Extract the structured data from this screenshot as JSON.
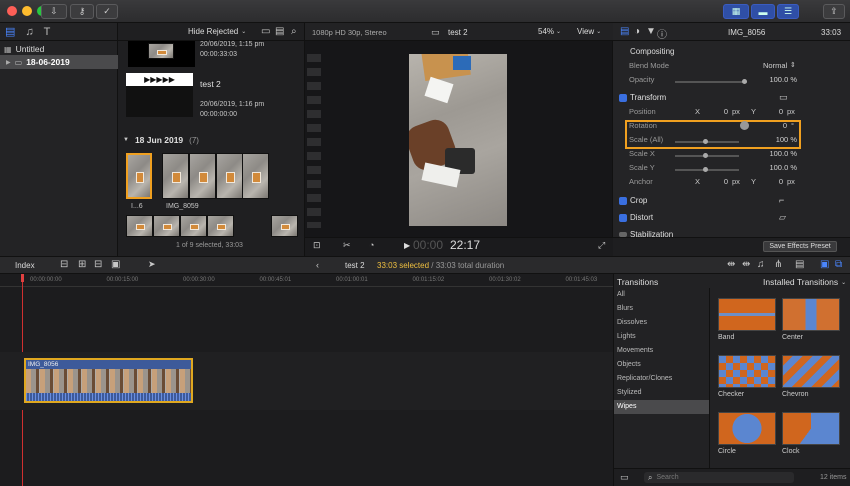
{
  "toolbar": {
    "download_icon": "download-icon",
    "key_icon": "key-icon",
    "check_icon": "checkmark-icon"
  },
  "libraries": {
    "library_name": "Untitled",
    "event_name": "18-06-2019"
  },
  "browser": {
    "filter_label": "Hide Rejected",
    "clip1": {
      "date": "20/06/2019, 1:15 pm",
      "duration": "00:00:33:03"
    },
    "clip2": {
      "name": "test 2",
      "date": "20/06/2019, 1:16 pm",
      "duration": "00:00:00:00"
    },
    "group_label": "18 Jun 2019",
    "group_count": "(7)",
    "clip3_name": "I...6",
    "clip4_name": "IMG_8059",
    "status": "1 of 9 selected, 33:03"
  },
  "viewer": {
    "format": "1080p HD 30p, Stereo",
    "project": "test 2",
    "zoom": "54%",
    "view_label": "View",
    "timecode_dim": "00:00",
    "timecode": "22:17"
  },
  "inspector": {
    "clip_name": "IMG_8056",
    "duration": "33:03",
    "compositing": "Compositing",
    "blend_label": "Blend Mode",
    "blend_value": "Normal",
    "opacity_label": "Opacity",
    "opacity_value": "100.0 %",
    "opacity_fraction": 1.0,
    "transform": "Transform",
    "position_label": "Position",
    "pos_x_label": "X",
    "pos_x": "0",
    "pos_x_unit": "px",
    "pos_y_label": "Y",
    "pos_y": "0",
    "pos_y_unit": "px",
    "rotation_label": "Rotation",
    "rotation_value": "0",
    "rotation_unit": "°",
    "scale_all_label": "Scale (All)",
    "scale_all_value": "100 %",
    "scale_x_label": "Scale X",
    "scale_x_value": "100.0 %",
    "scale_y_label": "Scale Y",
    "scale_y_value": "100.0 %",
    "anchor_label": "Anchor",
    "anchor_x_label": "X",
    "anchor_x": "0",
    "anchor_x_unit": "px",
    "anchor_y_label": "Y",
    "anchor_y": "0",
    "anchor_y_unit": "px",
    "crop": "Crop",
    "distort": "Distort",
    "stabilization": "Stabilization",
    "save_preset": "Save Effects Preset"
  },
  "timeline_bar": {
    "index": "Index",
    "project": "test 2",
    "selected": "33:03 selected",
    "separator": " / ",
    "total": "33:03 total duration"
  },
  "ruler": [
    "00:00:00:00",
    "00:00:15:00",
    "00:00:30:00",
    "00:00:45:01",
    "00:01:00:01",
    "00:01:15:02",
    "00:01:30:02",
    "00:01:45:03"
  ],
  "clip_label": "IMG_8056",
  "transitions": {
    "header": "Transitions",
    "installed": "Installed Transitions",
    "categories": [
      "All",
      "Blurs",
      "Dissolves",
      "Lights",
      "Movements",
      "Objects",
      "Replicator/Clones",
      "Stylized",
      "Wipes"
    ],
    "selected_category": "Wipes",
    "items": [
      "Band",
      "Center",
      "Checker",
      "Chevron",
      "Circle",
      "Clock"
    ],
    "search_placeholder": "Search",
    "count": "12 items"
  },
  "colors": {
    "accent": "#f0a020",
    "selection": "#3a6fe0",
    "tl_clip": "#e0a820"
  }
}
